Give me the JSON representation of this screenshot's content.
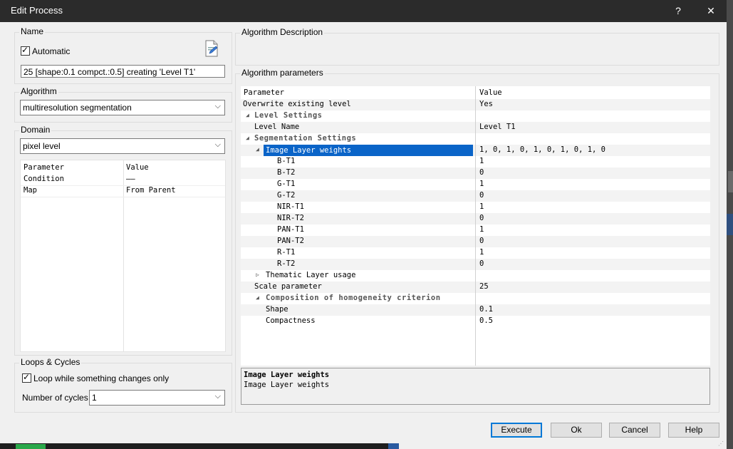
{
  "window": {
    "title": "Edit Process",
    "help_glyph": "?",
    "close_glyph": "✕"
  },
  "name_group": {
    "title": "Name",
    "automatic_label": "Automatic",
    "automatic_checked": true,
    "name_value": "25 [shape:0.1 compct.:0.5] creating 'Level T1'",
    "edit_icon": "document-edit-icon"
  },
  "algorithm_group": {
    "title": "Algorithm",
    "selected": "multiresolution segmentation"
  },
  "domain_group": {
    "title": "Domain",
    "selected": "pixel level",
    "table": {
      "headers": [
        "Parameter",
        "Value"
      ],
      "rows": [
        {
          "param": "Condition",
          "value": "——"
        },
        {
          "param": "Map",
          "value": "From Parent"
        }
      ]
    }
  },
  "loops_group": {
    "title": "Loops & Cycles",
    "loop_label": "Loop while something changes only",
    "loop_checked": true,
    "cycles_label": "Number of cycles",
    "cycles_value": "1"
  },
  "description_group": {
    "title": "Algorithm Description",
    "text": ""
  },
  "parameters_group": {
    "title": "Algorithm parameters",
    "headers": [
      "Parameter",
      "Value"
    ],
    "rows": [
      {
        "name": "Overwrite existing level",
        "value": "Yes",
        "level": 0,
        "kind": "param"
      },
      {
        "name": "Level Settings",
        "value": "",
        "level": 0,
        "kind": "category",
        "expanded": true
      },
      {
        "name": "Level Name",
        "value": "Level T1",
        "level": 1,
        "kind": "param"
      },
      {
        "name": "Segmentation Settings",
        "value": "",
        "level": 0,
        "kind": "category",
        "expanded": true
      },
      {
        "name": "Image Layer weights",
        "value": "1, 0, 1, 0, 1, 0, 1, 0, 1, 0",
        "level": 2,
        "kind": "group",
        "expanded": true,
        "selected": true
      },
      {
        "name": "B-T1",
        "value": "1",
        "level": 3,
        "kind": "param"
      },
      {
        "name": "B-T2",
        "value": "0",
        "level": 3,
        "kind": "param"
      },
      {
        "name": "G-T1",
        "value": "1",
        "level": 3,
        "kind": "param"
      },
      {
        "name": "G-T2",
        "value": "0",
        "level": 3,
        "kind": "param"
      },
      {
        "name": "NIR-T1",
        "value": "1",
        "level": 3,
        "kind": "param"
      },
      {
        "name": "NIR-T2",
        "value": "0",
        "level": 3,
        "kind": "param"
      },
      {
        "name": "PAN-T1",
        "value": "1",
        "level": 3,
        "kind": "param"
      },
      {
        "name": "PAN-T2",
        "value": "0",
        "level": 3,
        "kind": "param"
      },
      {
        "name": "R-T1",
        "value": "1",
        "level": 3,
        "kind": "param"
      },
      {
        "name": "R-T2",
        "value": "0",
        "level": 3,
        "kind": "param"
      },
      {
        "name": "Thematic Layer usage",
        "value": "",
        "level": 2,
        "kind": "group",
        "expanded": false
      },
      {
        "name": "Scale parameter",
        "value": "25",
        "level": 1,
        "kind": "param"
      },
      {
        "name": "Composition of homogeneity criterion",
        "value": "",
        "level": 2,
        "kind": "category",
        "expanded": true
      },
      {
        "name": "Shape",
        "value": "0.1",
        "level": 2,
        "kind": "param",
        "nogap": true
      },
      {
        "name": "Compactness",
        "value": "0.5",
        "level": 2,
        "kind": "param",
        "nogap": true
      }
    ],
    "selected_help_title": "Image Layer weights",
    "selected_help_text": "Image Layer weights"
  },
  "buttons": {
    "execute": "Execute",
    "ok": "Ok",
    "cancel": "Cancel",
    "help": "Help"
  }
}
